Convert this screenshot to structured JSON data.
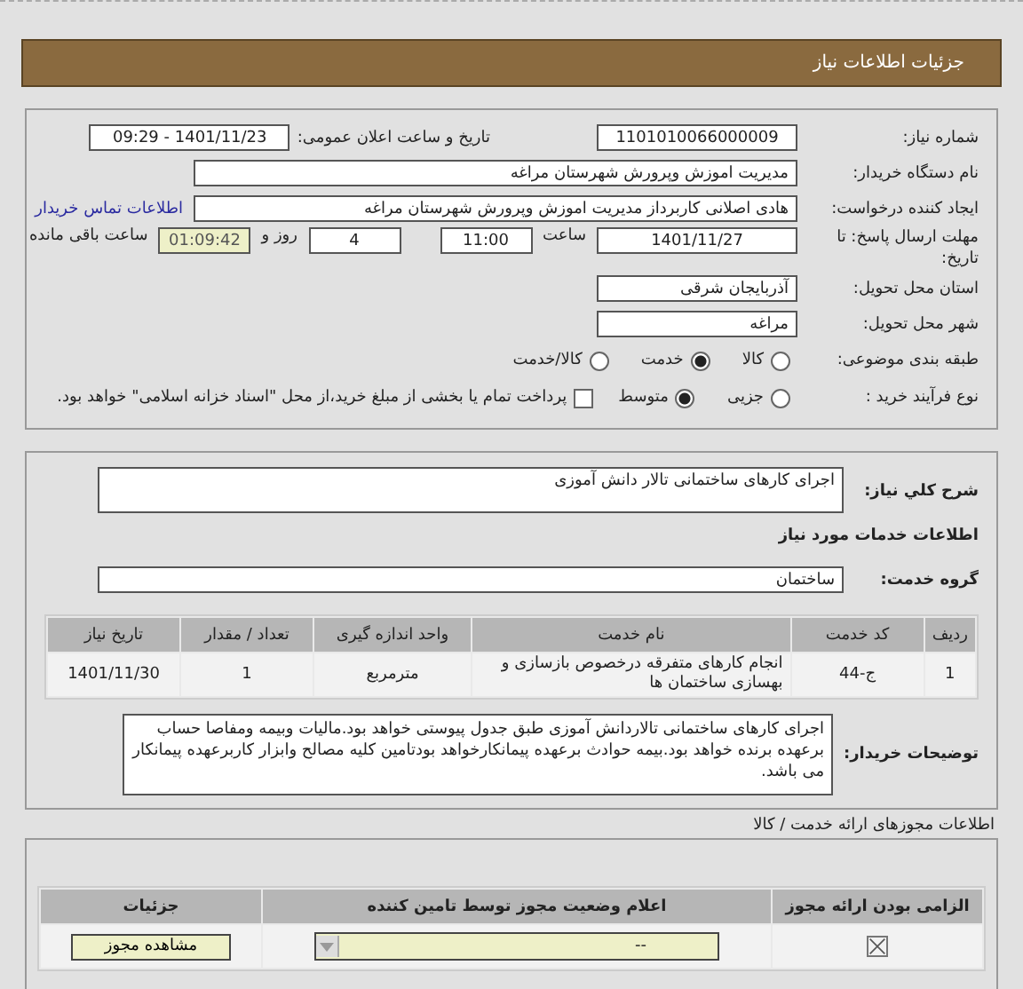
{
  "header": {
    "title": "جزئیات اطلاعات نیاز"
  },
  "need_number": {
    "label": "شماره نیاز:",
    "value": "1101010066000009"
  },
  "announce": {
    "label": "تاریخ و ساعت اعلان عمومی:",
    "value": "1401/11/23 - 09:29"
  },
  "buyer": {
    "label": "نام دستگاه خریدار:",
    "value": "مدیریت اموزش وپرورش شهرستان مراغه"
  },
  "requester": {
    "label": "ایجاد کننده درخواست:",
    "value": "هادی اصلانی کاربرداز مدیریت اموزش وپرورش شهرستان مراغه",
    "link": "اطلاعات تماس خریدار"
  },
  "deadline": {
    "label": "مهلت ارسال پاسخ: تا تاریخ:",
    "date": "1401/11/27",
    "time_label": "ساعت",
    "time": "11:00",
    "days": "4",
    "days_label": "روز و",
    "remaining": "01:09:42",
    "remaining_label": "ساعت باقی مانده"
  },
  "province": {
    "label": "استان محل تحویل:",
    "value": "آذربایجان شرقی"
  },
  "city": {
    "label": "شهر محل تحویل:",
    "value": "مراغه"
  },
  "category": {
    "label": "طبقه بندی موضوعی:",
    "options": [
      {
        "label": "کالا",
        "selected": false
      },
      {
        "label": "خدمت",
        "selected": true
      },
      {
        "label": "کالا/خدمت",
        "selected": false
      }
    ]
  },
  "process": {
    "label": "نوع فرآیند خرید :",
    "options": [
      {
        "label": "جزیی",
        "selected": false
      },
      {
        "label": "متوسط",
        "selected": true
      }
    ],
    "checkbox": {
      "label": "پرداخت تمام یا بخشی از مبلغ خرید،از محل \"اسناد خزانه اسلامی\" خواهد بود.",
      "checked": false
    }
  },
  "general": {
    "label": "شرح کلي نياز:",
    "value": "اجرای کارهای ساختمانی تالار دانش آموزی"
  },
  "services_title": "اطلاعات خدمات مورد نیاز",
  "service_group": {
    "label": "گروه خدمت:",
    "value": "ساختمان"
  },
  "items_table": {
    "columns": [
      "ردیف",
      "کد خدمت",
      "نام خدمت",
      "واحد اندازه گیری",
      "تعداد / مقدار",
      "تاریخ نیاز"
    ],
    "rows": [
      [
        "1",
        "ج-44",
        "انجام کارهای متفرقه درخصوص بازسازی و بهسازی ساختمان ها",
        "مترمربع",
        "1",
        "1401/11/30"
      ]
    ]
  },
  "buyer_notes": {
    "label": "توضیحات خریدار:",
    "value": "اجرای کارهای ساختمانی تالاردانش آموزی طبق جدول پیوستی خواهد بود.مالیات وبیمه ومفاصا حساب برعهده برنده خواهد بود.بیمه حوادث برعهده پیمانکارخواهد بودتامین کلیه مصالح وابزار کاربرعهده پیمانکار می باشد."
  },
  "permits_title": "اطلاعات مجوزهای ارائه خدمت / کالا",
  "permits_table": {
    "columns": [
      "الزامی بودن ارائه مجوز",
      "اعلام وضعیت مجوز توسط تامین کننده",
      "جزئیات"
    ],
    "rows": [
      {
        "required": true,
        "status": "--",
        "button": "مشاهده مجوز"
      }
    ]
  }
}
